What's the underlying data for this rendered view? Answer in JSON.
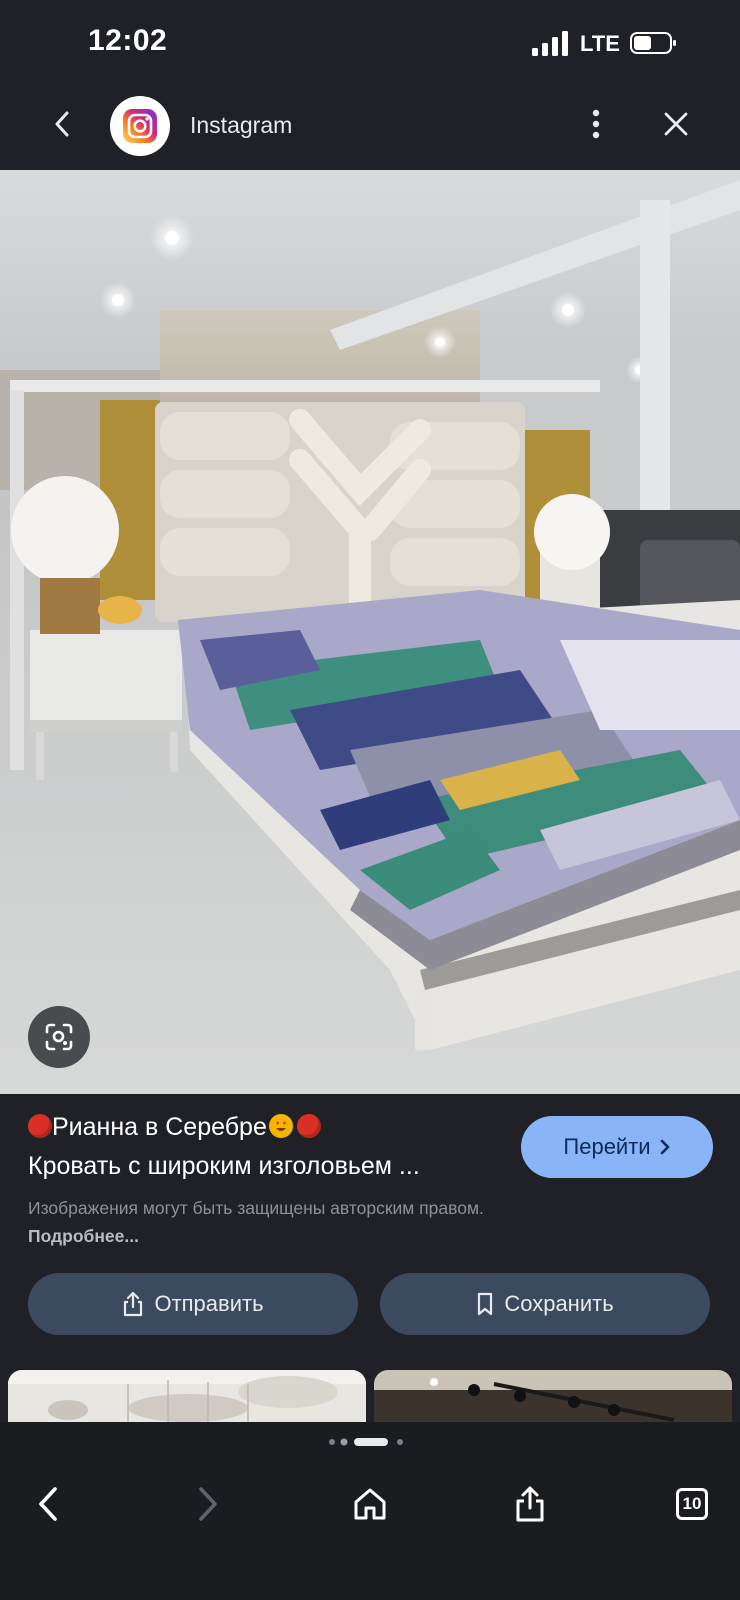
{
  "status_bar": {
    "time": "12:02",
    "network": "LTE"
  },
  "header": {
    "app_name": "Instagram"
  },
  "result": {
    "title_line1": "Рианна в Серебре",
    "title_line2": "Кровать с широким изголовьем ...",
    "go_label": "Перейти",
    "copyright_text": "Изображения могут быть защищены авторским правом.",
    "more_link": "Подробнее..."
  },
  "actions": {
    "share_label": "Отправить",
    "save_label": "Сохранить"
  },
  "browser_bar": {
    "tab_count": "10"
  },
  "colors": {
    "accent": "#8ab4f8",
    "background": "#1f2126",
    "button_bg": "#3c4a60"
  },
  "icons": [
    "back-icon",
    "instagram-logo-icon",
    "more-vert-icon",
    "close-icon",
    "lens-icon",
    "chevron-right-icon",
    "share-icon",
    "bookmark-icon",
    "home-icon",
    "forward-icon",
    "tabs-icon"
  ]
}
